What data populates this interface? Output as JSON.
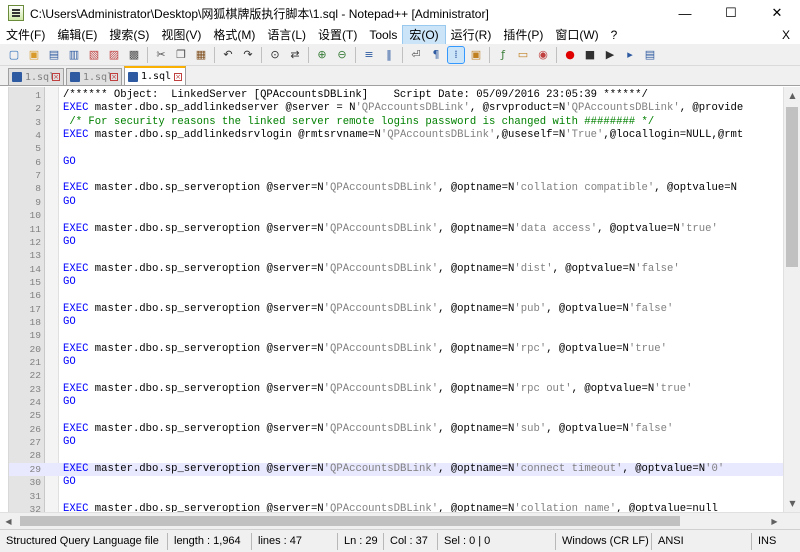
{
  "window": {
    "title": "C:\\Users\\Administrator\\Desktop\\网狐棋牌版执行脚本\\1.sql - Notepad++ [Administrator]",
    "minimize_glyph": "—",
    "maximize_glyph": "☐",
    "close_glyph": "✕"
  },
  "menu": {
    "items": [
      "文件(F)",
      "编辑(E)",
      "搜索(S)",
      "视图(V)",
      "格式(M)",
      "语言(L)",
      "设置(T)",
      "Tools",
      "宏(O)",
      "运行(R)",
      "插件(P)",
      "窗口(W)",
      "?"
    ],
    "active_index": 8,
    "close_label": "X"
  },
  "toolbar": {
    "icons": [
      "new-file-icon",
      "open-file-icon",
      "save-icon",
      "save-all-icon",
      "close-icon",
      "close-all-icon",
      "print-icon",
      "cut-icon",
      "copy-icon",
      "paste-icon",
      "undo-icon",
      "redo-icon",
      "find-icon",
      "replace-icon",
      "zoom-in-icon",
      "zoom-out-icon",
      "sync-vertical-icon",
      "sync-horizontal-icon",
      "word-wrap-icon",
      "show-all-chars-icon",
      "indent-guide-icon",
      "doc-map-icon",
      "function-list-icon",
      "folder-workspace-icon",
      "monitoring-icon",
      "record-macro-icon",
      "stop-record-icon",
      "play-macro-icon",
      "run-macro-multiple-icon",
      "save-macro-icon"
    ],
    "glyphs": [
      "▢",
      "▣",
      "▤",
      "▥",
      "▧",
      "▨",
      "▩",
      "✂",
      "❐",
      "▦",
      "↶",
      "↷",
      "⊙",
      "⇄",
      "⊕",
      "⊖",
      "≡",
      "‖",
      "⏎",
      "¶",
      "⁞",
      "▣",
      "ƒ",
      "▭",
      "◉",
      "●",
      "■",
      "▶",
      "▸",
      "▤"
    ]
  },
  "tabs": [
    {
      "label": "1.sql",
      "active": false
    },
    {
      "label": "1.sql",
      "active": false
    },
    {
      "label": "1.sql",
      "active": true
    }
  ],
  "editor": {
    "current_line": 29,
    "lines": [
      {
        "n": "1",
        "parts": [
          [
            "c",
            "/****** Object:  LinkedServer [QPAccountsDBLink]    Script Date: 05/09/2016 23:05:39 ******/"
          ]
        ]
      },
      {
        "n": "2",
        "parts": [
          [
            "k",
            "EXEC"
          ],
          [
            "o",
            " master.dbo.sp_addlinkedserver @server = N"
          ],
          [
            "s",
            "'QPAccountsDBLink'"
          ],
          [
            "o",
            ", @srvproduct=N"
          ],
          [
            "s",
            "'QPAccountsDBLink'"
          ],
          [
            "o",
            ", @provide"
          ]
        ]
      },
      {
        "n": "3",
        "parts": [
          [
            "m",
            " /* For security reasons the linked server remote logins password is changed with ######## */"
          ]
        ]
      },
      {
        "n": "4",
        "parts": [
          [
            "k",
            "EXEC"
          ],
          [
            "o",
            " master.dbo.sp_addlinkedsrvlogin @rmtsrvname=N"
          ],
          [
            "s",
            "'QPAccountsDBLink'"
          ],
          [
            "o",
            ",@useself=N"
          ],
          [
            "s",
            "'True'"
          ],
          [
            "o",
            ",@locallogin=NULL,@rmt"
          ]
        ]
      },
      {
        "n": "5",
        "parts": []
      },
      {
        "n": "6",
        "parts": [
          [
            "k",
            "GO"
          ]
        ]
      },
      {
        "n": "7",
        "parts": []
      },
      {
        "n": "8",
        "parts": [
          [
            "k",
            "EXEC"
          ],
          [
            "o",
            " master.dbo.sp_serveroption @server=N"
          ],
          [
            "s",
            "'QPAccountsDBLink'"
          ],
          [
            "o",
            ", @optname=N"
          ],
          [
            "s",
            "'collation compatible'"
          ],
          [
            "o",
            ", @optvalue=N"
          ]
        ]
      },
      {
        "n": "9",
        "parts": [
          [
            "k",
            "GO"
          ]
        ]
      },
      {
        "n": "10",
        "parts": []
      },
      {
        "n": "11",
        "parts": [
          [
            "k",
            "EXEC"
          ],
          [
            "o",
            " master.dbo.sp_serveroption @server=N"
          ],
          [
            "s",
            "'QPAccountsDBLink'"
          ],
          [
            "o",
            ", @optname=N"
          ],
          [
            "s",
            "'data access'"
          ],
          [
            "o",
            ", @optvalue=N"
          ],
          [
            "s",
            "'true'"
          ]
        ]
      },
      {
        "n": "12",
        "parts": [
          [
            "k",
            "GO"
          ]
        ]
      },
      {
        "n": "13",
        "parts": []
      },
      {
        "n": "14",
        "parts": [
          [
            "k",
            "EXEC"
          ],
          [
            "o",
            " master.dbo.sp_serveroption @server=N"
          ],
          [
            "s",
            "'QPAccountsDBLink'"
          ],
          [
            "o",
            ", @optname=N"
          ],
          [
            "s",
            "'dist'"
          ],
          [
            "o",
            ", @optvalue=N"
          ],
          [
            "s",
            "'false'"
          ]
        ]
      },
      {
        "n": "15",
        "parts": [
          [
            "k",
            "GO"
          ]
        ]
      },
      {
        "n": "16",
        "parts": []
      },
      {
        "n": "17",
        "parts": [
          [
            "k",
            "EXEC"
          ],
          [
            "o",
            " master.dbo.sp_serveroption @server=N"
          ],
          [
            "s",
            "'QPAccountsDBLink'"
          ],
          [
            "o",
            ", @optname=N"
          ],
          [
            "s",
            "'pub'"
          ],
          [
            "o",
            ", @optvalue=N"
          ],
          [
            "s",
            "'false'"
          ]
        ]
      },
      {
        "n": "18",
        "parts": [
          [
            "k",
            "GO"
          ]
        ]
      },
      {
        "n": "19",
        "parts": []
      },
      {
        "n": "20",
        "parts": [
          [
            "k",
            "EXEC"
          ],
          [
            "o",
            " master.dbo.sp_serveroption @server=N"
          ],
          [
            "s",
            "'QPAccountsDBLink'"
          ],
          [
            "o",
            ", @optname=N"
          ],
          [
            "s",
            "'rpc'"
          ],
          [
            "o",
            ", @optvalue=N"
          ],
          [
            "s",
            "'true'"
          ]
        ]
      },
      {
        "n": "21",
        "parts": [
          [
            "k",
            "GO"
          ]
        ]
      },
      {
        "n": "22",
        "parts": []
      },
      {
        "n": "23",
        "parts": [
          [
            "k",
            "EXEC"
          ],
          [
            "o",
            " master.dbo.sp_serveroption @server=N"
          ],
          [
            "s",
            "'QPAccountsDBLink'"
          ],
          [
            "o",
            ", @optname=N"
          ],
          [
            "s",
            "'rpc out'"
          ],
          [
            "o",
            ", @optvalue=N"
          ],
          [
            "s",
            "'true'"
          ]
        ]
      },
      {
        "n": "24",
        "parts": [
          [
            "k",
            "GO"
          ]
        ]
      },
      {
        "n": "25",
        "parts": []
      },
      {
        "n": "26",
        "parts": [
          [
            "k",
            "EXEC"
          ],
          [
            "o",
            " master.dbo.sp_serveroption @server=N"
          ],
          [
            "s",
            "'QPAccountsDBLink'"
          ],
          [
            "o",
            ", @optname=N"
          ],
          [
            "s",
            "'sub'"
          ],
          [
            "o",
            ", @optvalue=N"
          ],
          [
            "s",
            "'false'"
          ]
        ]
      },
      {
        "n": "27",
        "parts": [
          [
            "k",
            "GO"
          ]
        ]
      },
      {
        "n": "28",
        "parts": []
      },
      {
        "n": "29",
        "parts": [
          [
            "k",
            "EXEC"
          ],
          [
            "o",
            " master.dbo.sp_serveroption @server=N"
          ],
          [
            "s",
            "'QPAccountsDBLink'"
          ],
          [
            "o",
            ", @optname=N"
          ],
          [
            "s",
            "'connect timeout'"
          ],
          [
            "o",
            ", @optvalue=N"
          ],
          [
            "s",
            "'0'"
          ]
        ]
      },
      {
        "n": "30",
        "parts": [
          [
            "k",
            "GO"
          ]
        ]
      },
      {
        "n": "31",
        "parts": []
      },
      {
        "n": "32",
        "parts": [
          [
            "k",
            "EXEC"
          ],
          [
            "o",
            " master.dbo.sp_serveroption @server=N"
          ],
          [
            "s",
            "'QPAccountsDBLink'"
          ],
          [
            "o",
            ", @optname=N"
          ],
          [
            "s",
            "'collation name'"
          ],
          [
            "o",
            ", @optvalue=null"
          ]
        ]
      }
    ]
  },
  "scroll": {
    "up": "▲",
    "down": "▼",
    "left": "◀",
    "right": "▶"
  },
  "status": {
    "file_type": "Structured Query Language file",
    "length": "length : 1,964",
    "lines": "lines : 47",
    "ln": "Ln : 29",
    "col": "Col : 37",
    "sel": "Sel : 0 | 0",
    "eol": "Windows (CR LF)",
    "encoding": "ANSI",
    "mode": "INS"
  },
  "colors": {
    "keyword": "#0000ff",
    "string": "#808080",
    "comment": "#008000",
    "current_line": "#e8e8ff",
    "active_tab_accent": "#fab000"
  }
}
